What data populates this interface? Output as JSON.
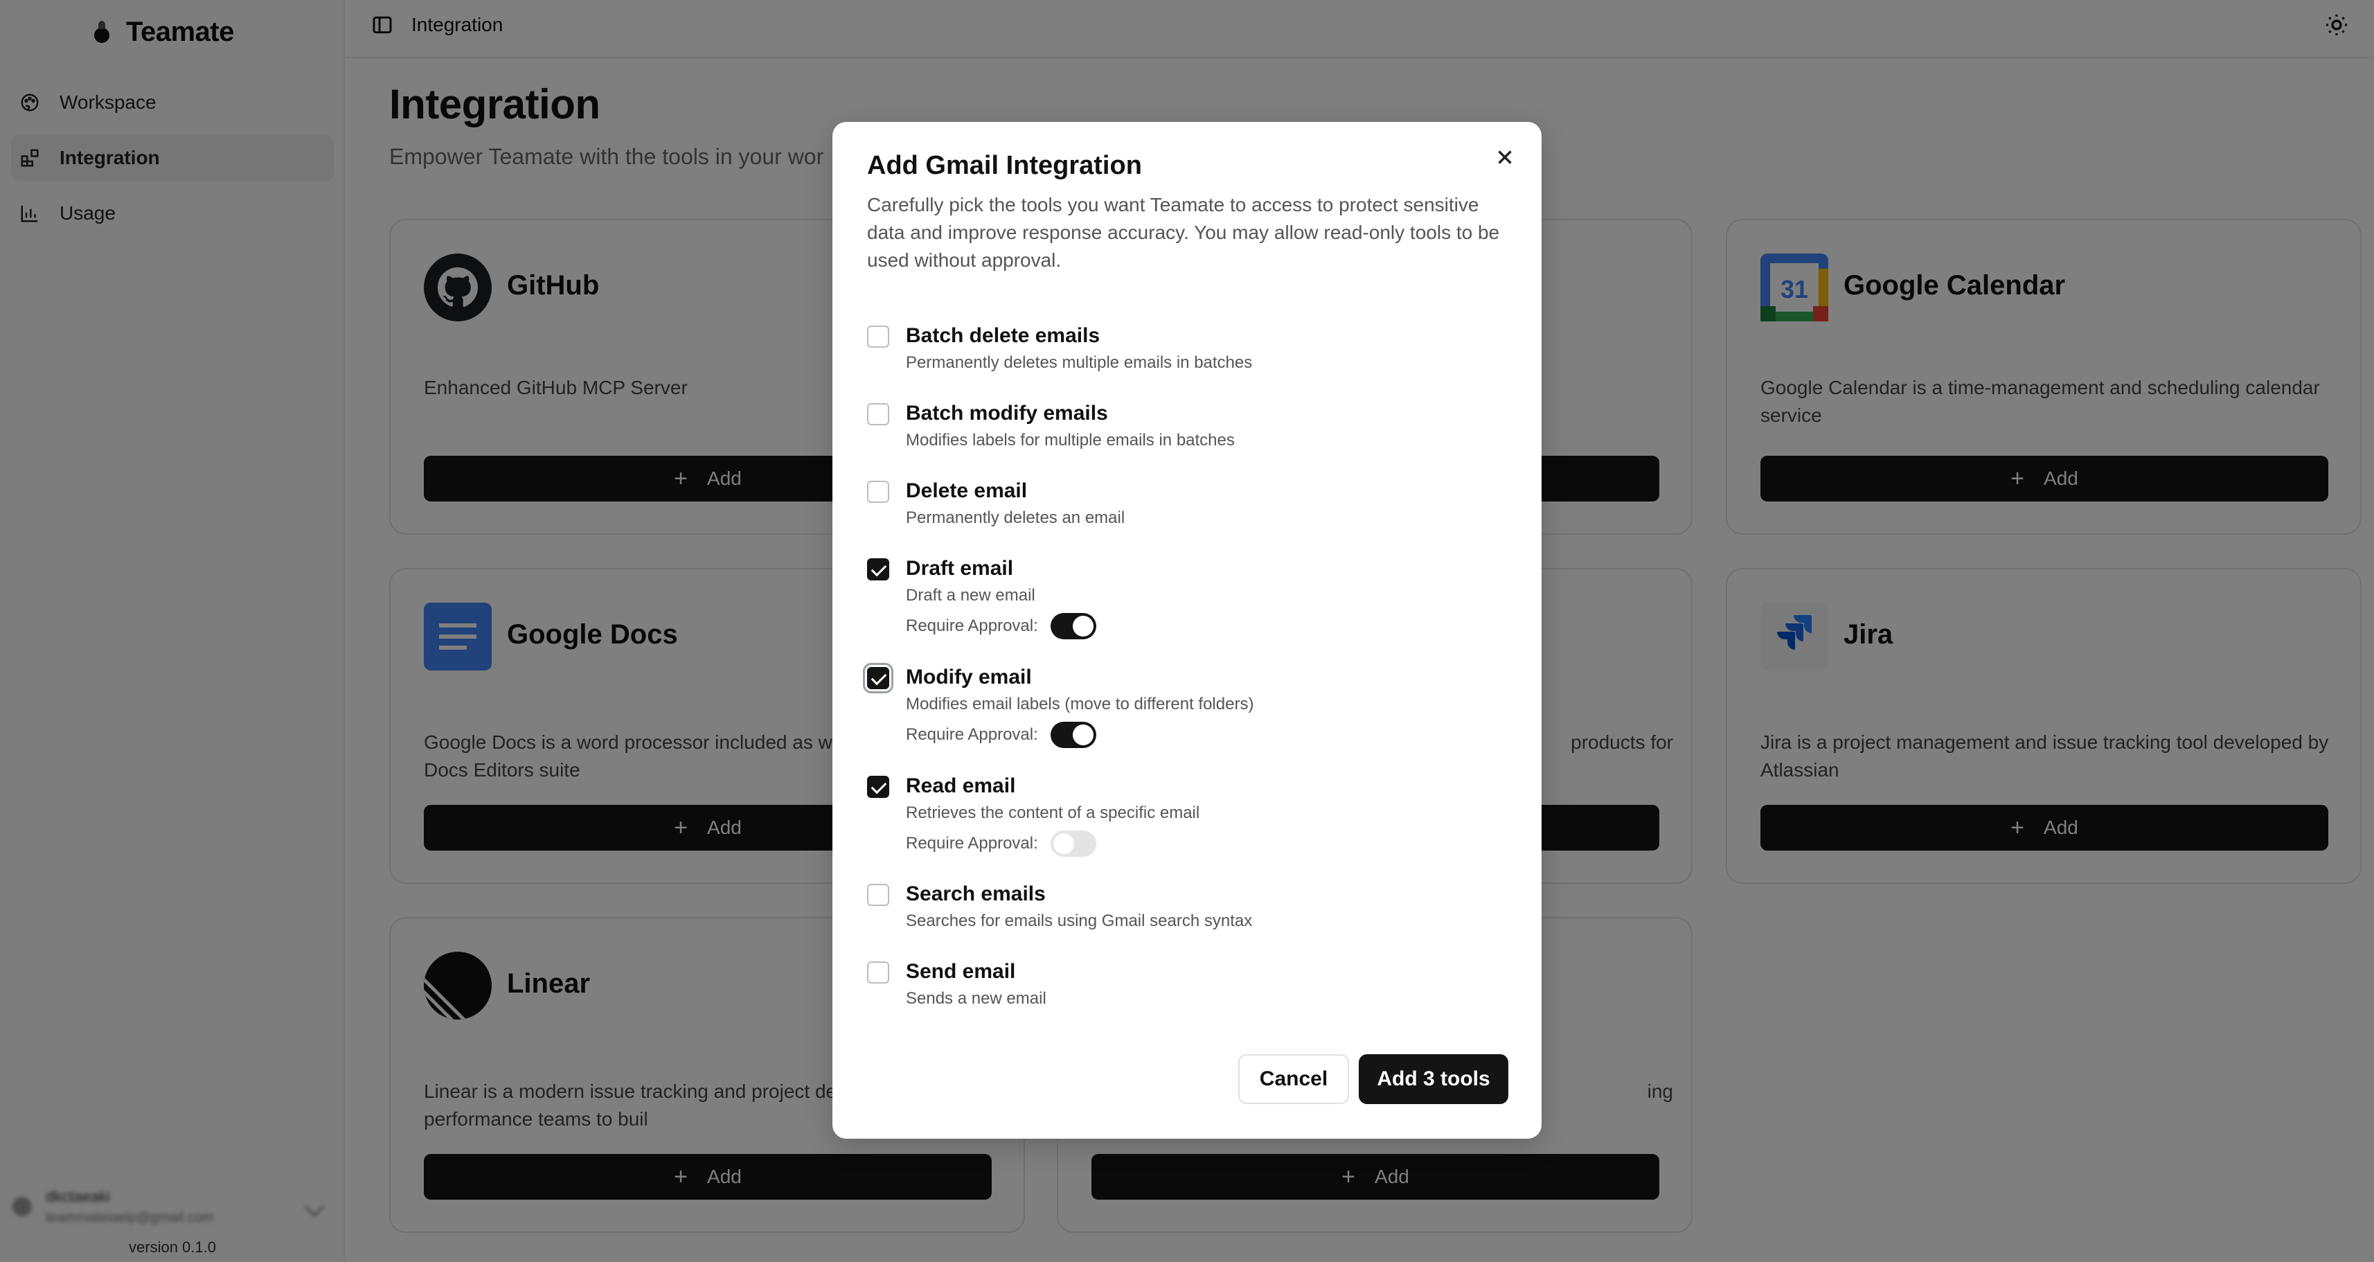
{
  "app": {
    "brand": "Teamate",
    "version": "version 0.1.0"
  },
  "sidebar": {
    "items": [
      {
        "label": "Workspace",
        "icon": "palette-icon"
      },
      {
        "label": "Integration",
        "icon": "blocks-icon"
      },
      {
        "label": "Usage",
        "icon": "bar-chart-icon"
      }
    ],
    "user": {
      "name": "dkctaeaki",
      "email": "teammateiaeip@gmail.com"
    }
  },
  "header": {
    "title": "Integration"
  },
  "main": {
    "title": "Integration",
    "subtitle": "Empower Teamate with the tools in your wor",
    "add_label": "Add",
    "cards": [
      {
        "name": "GitHub",
        "desc": "Enhanced GitHub MCP Server"
      },
      {
        "name": "Google Calendar",
        "desc": "Google Calendar is a time-management and scheduling calendar service"
      },
      {
        "name": "Google Docs",
        "desc": "Google Docs is a word processor included as web-based Google Docs Editors suite"
      },
      {
        "name": "",
        "desc": "products for"
      },
      {
        "name": "Jira",
        "desc": "Jira is a project management and issue tracking tool developed by Atlassian"
      },
      {
        "name": "Linear",
        "desc": "Linear is a modern issue tracking and project designed for high-performance teams to buil"
      },
      {
        "name": "",
        "desc": "ing"
      }
    ]
  },
  "modal": {
    "title": "Add Gmail Integration",
    "description": "Carefully pick the tools you want Teamate to access to protect sensitive data and improve response accuracy. You may allow read-only tools to be used without approval.",
    "approval_label": "Require Approval:",
    "tools": [
      {
        "name": "Batch delete emails",
        "desc": "Permanently deletes multiple emails in batches",
        "checked": false
      },
      {
        "name": "Batch modify emails",
        "desc": "Modifies labels for multiple emails in batches",
        "checked": false
      },
      {
        "name": "Delete email",
        "desc": "Permanently deletes an email",
        "checked": false
      },
      {
        "name": "Draft email",
        "desc": "Draft a new email",
        "checked": true,
        "require_approval": true
      },
      {
        "name": "Modify email",
        "desc": "Modifies email labels (move to different folders)",
        "checked": true,
        "require_approval": true
      },
      {
        "name": "Read email",
        "desc": "Retrieves the content of a specific email",
        "checked": true,
        "require_approval": false
      },
      {
        "name": "Search emails",
        "desc": "Searches for emails using Gmail search syntax",
        "checked": false
      },
      {
        "name": "Send email",
        "desc": "Sends a new email",
        "checked": false
      }
    ],
    "cancel_label": "Cancel",
    "submit_label": "Add 3 tools"
  },
  "colors": {
    "primary": "#141414",
    "overlay": "rgba(0,0,0,0.5)"
  }
}
